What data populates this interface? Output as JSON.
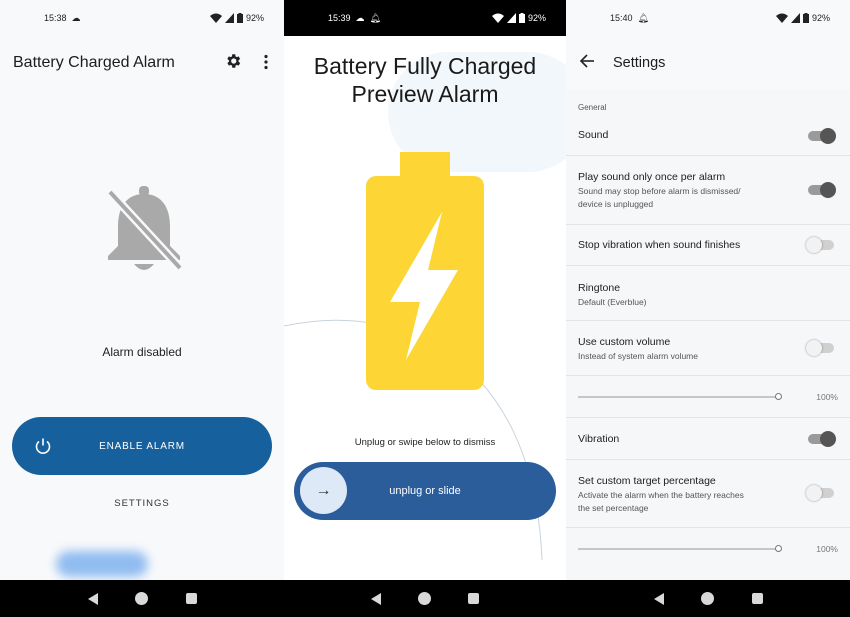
{
  "screen1": {
    "status": {
      "time": "15:38",
      "battery": "92%"
    },
    "app_title": "Battery Charged Alarm",
    "alarm_status": "Alarm disabled",
    "enable_button": "ENABLE ALARM",
    "settings_link": "SETTINGS"
  },
  "screen2": {
    "status": {
      "time": "15:39",
      "battery": "92%"
    },
    "title_line1": "Battery Fully Charged",
    "title_line2": "Preview Alarm",
    "dismiss_hint": "Unplug or swipe below to dismiss",
    "slider_label": "unplug or slide",
    "battery_color": "#FDD535",
    "button_color": "#2C5D9B"
  },
  "screen3": {
    "status": {
      "time": "15:40",
      "battery": "92%"
    },
    "title": "Settings",
    "section": "General",
    "sound": {
      "label": "Sound",
      "on": true
    },
    "play_once": {
      "label": "Play sound only once per alarm",
      "sub1": "Sound may stop before alarm is dismissed/",
      "sub2": "device is unplugged",
      "on": true
    },
    "stop_vibration": {
      "label": "Stop vibration when sound finishes",
      "on": false
    },
    "ringtone": {
      "label": "Ringtone",
      "value": "Default (Everblue)"
    },
    "custom_volume": {
      "label": "Use custom volume",
      "sub": "Instead of system alarm volume",
      "on": false
    },
    "volume_slider": {
      "value": "100%",
      "level": 1.0
    },
    "vibration": {
      "label": "Vibration",
      "on": true
    },
    "target": {
      "label": "Set custom target percentage",
      "sub1": "Activate the alarm when the battery reaches",
      "sub2": "the set percentage",
      "on": false
    },
    "target_slider": {
      "value": "100%",
      "level": 1.0
    }
  },
  "icons": [
    "cloud-icon",
    "wifi-icon",
    "signal-icon",
    "battery-icon",
    "gear-icon",
    "more-vert-icon",
    "bell-off-icon",
    "power-icon",
    "notification-bell-icon",
    "battery-charging-icon",
    "arrow-right-icon",
    "back-arrow-icon",
    "nav-back-icon",
    "nav-home-icon",
    "nav-recents-icon"
  ]
}
